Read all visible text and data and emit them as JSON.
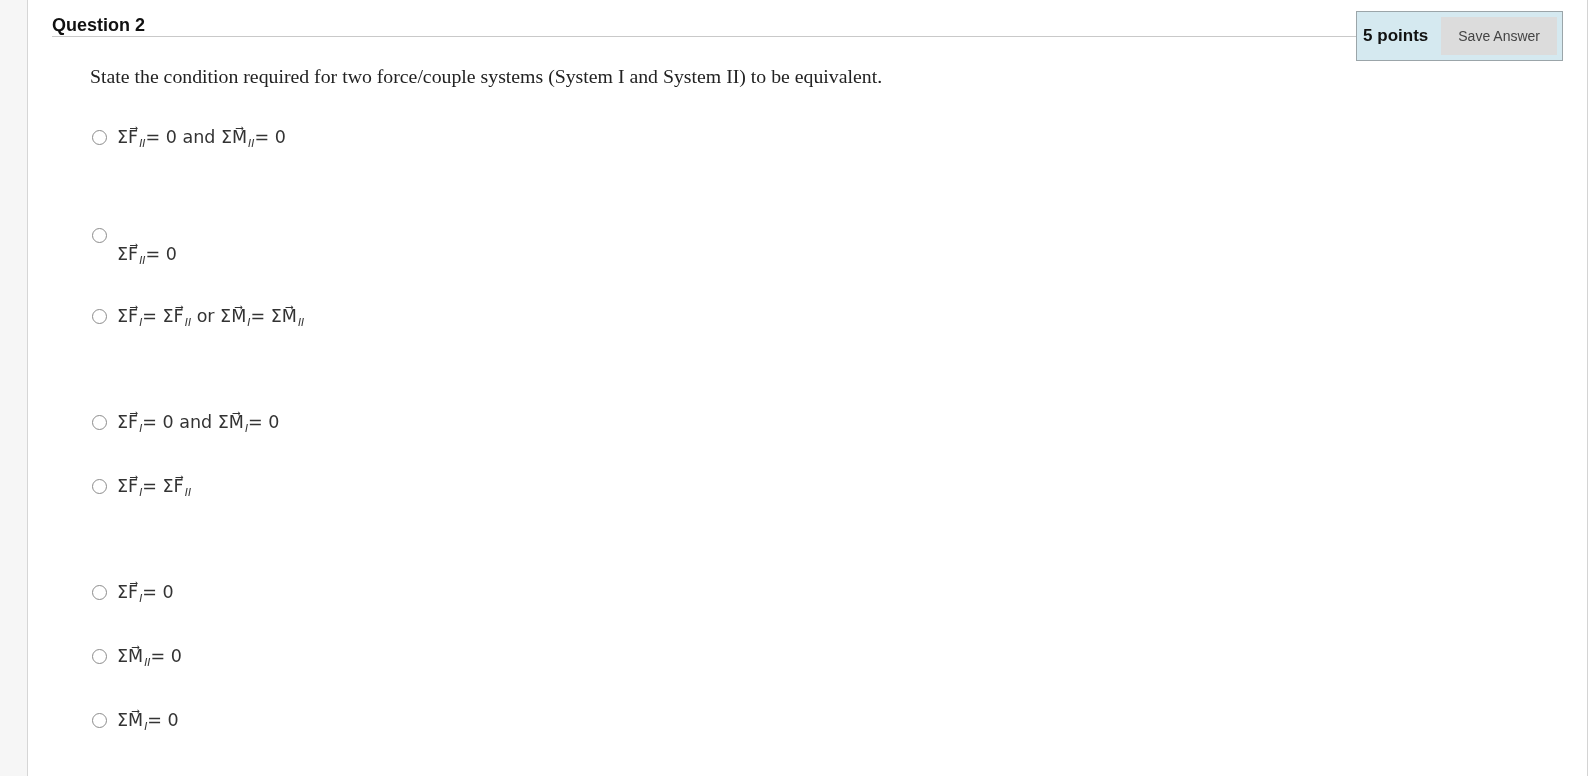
{
  "question": {
    "title": "Question 2",
    "points": "5 points",
    "save_button": "Save Answer",
    "prompt": "State the condition required for two force/couple systems (System I and System II) to be equivalent."
  },
  "options": [
    {
      "kind": "inline",
      "text": "ΣF⃗$_{II}$= 0 and ΣM⃗$_{II}$= 0",
      "selected": false
    },
    {
      "kind": "stacked",
      "text": "ΣF⃗$_{II}$= 0",
      "selected": false
    },
    {
      "kind": "inline",
      "text": "ΣF⃗$_{I}$= ΣF⃗$_{II}$ or ΣM⃗$_{I}$= ΣM⃗$_{II}$",
      "selected": false
    },
    {
      "kind": "inline",
      "text": "ΣF⃗$_{I}$= 0 and ΣM⃗$_{I}$= 0",
      "selected": false
    },
    {
      "kind": "inline",
      "text": "ΣF⃗$_{I}$= ΣF⃗$_{II}$",
      "selected": false
    },
    {
      "kind": "inline",
      "text": "ΣF⃗$_{I}$= 0",
      "selected": false
    },
    {
      "kind": "inline",
      "text": "ΣM⃗$_{II}$= 0",
      "selected": false
    },
    {
      "kind": "inline",
      "text": "ΣM⃗$_{I}$= 0",
      "selected": false
    }
  ]
}
